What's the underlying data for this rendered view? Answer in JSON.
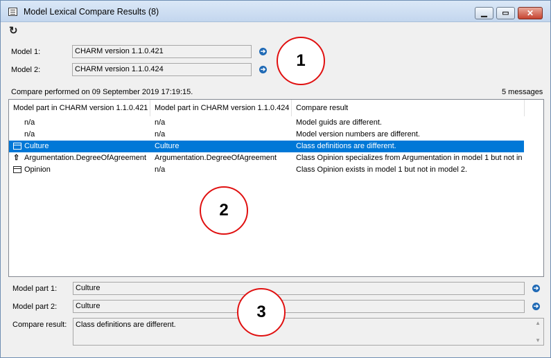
{
  "window": {
    "title": "Model Lexical Compare Results (8)",
    "buttons": {
      "minimize": "▁",
      "maximize": "▭",
      "close": "✕"
    }
  },
  "toolbar": {
    "refresh_icon": "refresh-icon",
    "refresh_glyph": "↻"
  },
  "models": {
    "model1": {
      "label": "Model 1:",
      "value": "CHARM version 1.1.0.421"
    },
    "model2": {
      "label": "Model 2:",
      "value": "CHARM version 1.1.0.424"
    },
    "nav_glyph": "➔"
  },
  "status": {
    "compare_text": "Compare performed on 09 September 2019 17:19:15.",
    "messages": "5 messages"
  },
  "table": {
    "columns": [
      "Model part in CHARM version 1.1.0.421",
      "Model part in CHARM version 1.1.0.424",
      "Compare result"
    ],
    "rows": [
      {
        "icon": "",
        "part1": "n/a",
        "part2": "n/a",
        "result": "Model guids are different."
      },
      {
        "icon": "",
        "part1": "n/a",
        "part2": "n/a",
        "result": "Model version numbers are different."
      },
      {
        "icon": "class-icon",
        "part1": "Culture",
        "part2": "Culture",
        "result": "Class definitions are different.",
        "selected": true
      },
      {
        "icon": "generalization-icon",
        "part1": "Argumentation.DegreeOfAgreement",
        "part2": "Argumentation.DegreeOfAgreement",
        "result": "Class Opinion specializes from Argumentation in model 1 but not in ..."
      },
      {
        "icon": "class-icon",
        "part1": "Opinion",
        "part2": "n/a",
        "result": "Class Opinion exists in model 1 but not in model 2."
      }
    ]
  },
  "details": {
    "part1": {
      "label": "Model part 1:",
      "value": "Culture"
    },
    "part2": {
      "label": "Model part 2:",
      "value": "Culture"
    },
    "result": {
      "label": "Compare result:",
      "value": "Class definitions are different."
    }
  },
  "annotations": [
    "1",
    "2",
    "3"
  ],
  "colors": {
    "selection": "#0078d7",
    "annotation_circle": "#e01010",
    "nav_button": "#1e69b5"
  }
}
